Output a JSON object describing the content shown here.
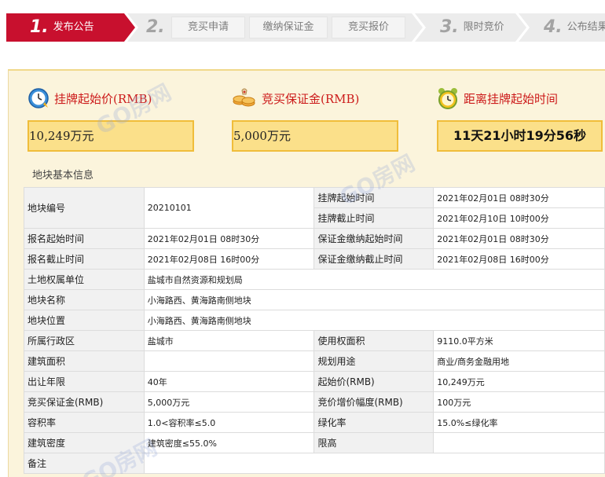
{
  "steps": [
    {
      "num": "1.",
      "label": "发布公告"
    },
    {
      "num": "2.",
      "label": ""
    },
    {
      "num": "3.",
      "label": "限时竞价"
    },
    {
      "num": "4.",
      "label": "公布结果"
    }
  ],
  "substeps": [
    "竞买申请",
    "缴纳保证金",
    "竞买报价"
  ],
  "summary": {
    "start_price_title": "挂牌起始价(RMB)",
    "start_price_value": "10,249万元",
    "deposit_title": "竞买保证金(RMB)",
    "deposit_value": "5,000万元",
    "countdown_title": "距离挂牌起始时间",
    "countdown_value": "11天21小时19分56秒"
  },
  "section_title": "地块基本信息",
  "table": {
    "parcel_no_label": "地块编号",
    "parcel_no_value": "20210101",
    "listing_start_label": "挂牌起始时间",
    "listing_start_value": "2021年02月01日 08时30分",
    "listing_end_label": "挂牌截止时间",
    "listing_end_value": "2021年02月10日 10时00分",
    "reg_start_label": "报名起始时间",
    "reg_start_value": "2021年02月01日 08时30分",
    "deposit_start_label": "保证金缴纳起始时间",
    "deposit_start_value": "2021年02月01日 08时30分",
    "reg_end_label": "报名截止时间",
    "reg_end_value": "2021年02月08日 16时00分",
    "deposit_end_label": "保证金缴纳截止时间",
    "deposit_end_value": "2021年02月08日 16时00分",
    "owner_label": "土地权属单位",
    "owner_value": "盐城市自然资源和规划局",
    "name_label": "地块名称",
    "name_value": "小海路西、黄海路南侧地块",
    "location_label": "地块位置",
    "location_value": "小海路西、黄海路南侧地块",
    "district_label": "所属行政区",
    "district_value": "盐城市",
    "area_label": "使用权面积",
    "area_value": "9110.0平方米",
    "building_area_label": "建筑面积",
    "building_area_value": "",
    "planning_use_label": "规划用途",
    "planning_use_value": "商业/商务金融用地",
    "term_label": "出让年限",
    "term_value": "40年",
    "start_price_label": "起始价(RMB)",
    "start_price_value": "10,249万元",
    "bid_deposit_label": "竞买保证金(RMB)",
    "bid_deposit_value": "5,000万元",
    "increment_label": "竞价增价幅度(RMB)",
    "increment_value": "100万元",
    "far_label": "容积率",
    "far_value": "1.0<容积率≤5.0",
    "green_label": "绿化率",
    "green_value": "15.0%≤绿化率",
    "density_label": "建筑密度",
    "density_value": "建筑密度≤55.0%",
    "height_label": "限高",
    "height_value": "",
    "remarks_label": "备注",
    "remarks_value": ""
  },
  "watermark": "GO房网",
  "icons": {
    "start_price": "clock-icon",
    "deposit": "coins-icon",
    "countdown": "alarm-clock-icon"
  },
  "colors": {
    "active_step": "#c8102e",
    "title_red": "#cc1a1a",
    "value_box": "#fbe08a",
    "panel_bg": "#fbf4dc"
  }
}
